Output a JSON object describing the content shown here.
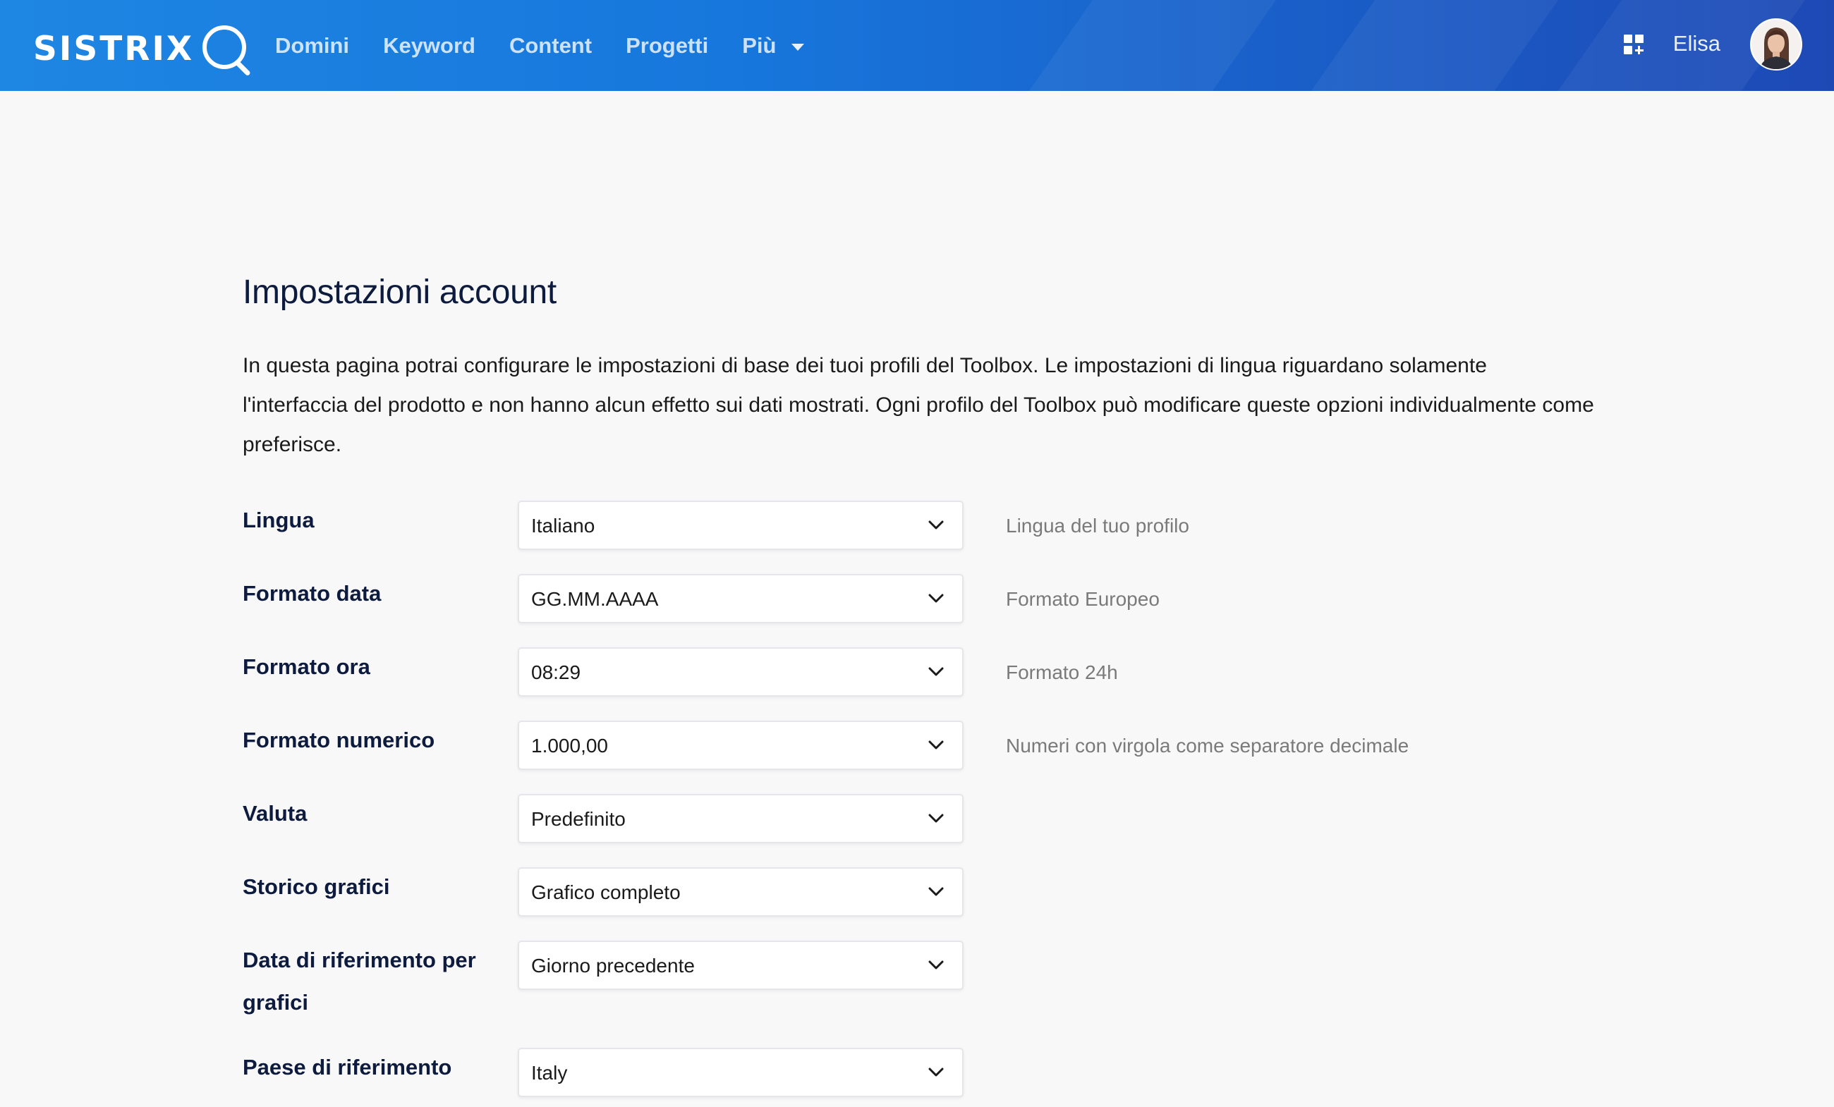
{
  "header": {
    "logo_text": "SISTRIX",
    "nav": [
      {
        "label": "Domini"
      },
      {
        "label": "Keyword"
      },
      {
        "label": "Content"
      },
      {
        "label": "Progetti"
      },
      {
        "label": "Più"
      }
    ],
    "user_name": "Elisa",
    "colors": {
      "bar_start": "#1e86e3",
      "bar_end": "#1d49b5"
    }
  },
  "page": {
    "title": "Impostazioni account",
    "intro": "In questa pagina potrai configurare le impostazioni di base dei tuoi profili del Toolbox. Le impostazioni di lingua riguardano solamente l'interfaccia del prodotto e non hanno alcun effetto sui dati mostrati. Ogni profilo del Toolbox può modificare queste opzioni individualmente come preferisce."
  },
  "settings": [
    {
      "label": "Lingua",
      "value": "Italiano",
      "hint": "Lingua del tuo profilo"
    },
    {
      "label": "Formato data",
      "value": "GG.MM.AAAA",
      "hint": "Formato Europeo"
    },
    {
      "label": "Formato ora",
      "value": "08:29",
      "hint": "Formato 24h"
    },
    {
      "label": "Formato numerico",
      "value": "1.000,00",
      "hint": "Numeri con virgola come separatore decimale"
    },
    {
      "label": "Valuta",
      "value": "Predefinito",
      "hint": ""
    },
    {
      "label": "Storico grafici",
      "value": "Grafico completo",
      "hint": ""
    },
    {
      "label": "Data di riferimento per grafici",
      "value": "Giorno precedente",
      "hint": ""
    },
    {
      "label": "Paese di riferimento",
      "value": "Italy",
      "hint": ""
    }
  ]
}
